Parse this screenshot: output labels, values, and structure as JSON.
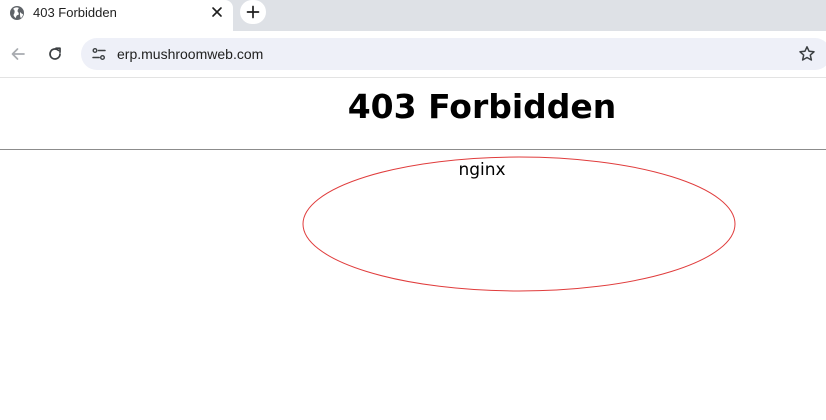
{
  "tab": {
    "title": "403 Forbidden",
    "favicon": "globe-icon"
  },
  "toolbar": {
    "back_icon": "arrow-left-icon",
    "reload_icon": "reload-icon",
    "site_info_icon": "tune-icon",
    "bookmark_icon": "star-icon"
  },
  "omnibox": {
    "url": "erp.mushroomweb.com"
  },
  "page": {
    "heading": "403 Forbidden",
    "server": "nginx"
  },
  "colors": {
    "tabstrip": "#dee1e6",
    "omnibox": "#eef0f8",
    "annotation": "#e03c3c"
  }
}
